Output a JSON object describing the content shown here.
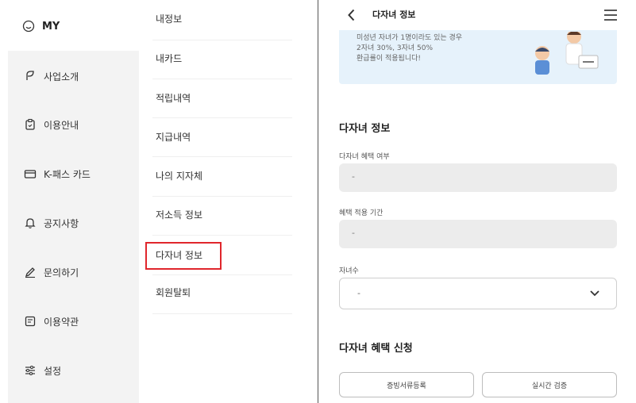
{
  "left": {
    "my_label": "MY",
    "sidebar_items": [
      {
        "label": "사업소개",
        "icon": "leaf-icon"
      },
      {
        "label": "이용안내",
        "icon": "clipboard-icon"
      },
      {
        "label": "K-패스 카드",
        "icon": "card-icon"
      },
      {
        "label": "공지사항",
        "icon": "bell-icon"
      },
      {
        "label": "문의하기",
        "icon": "pencil-icon"
      },
      {
        "label": "이용약관",
        "icon": "document-icon"
      },
      {
        "label": "설정",
        "icon": "settings-icon"
      }
    ],
    "submenu_items": [
      "내정보",
      "내카드",
      "적립내역",
      "지급내역",
      "나의 지자체",
      "저소득 정보",
      "다자녀 정보",
      "회원탈퇴"
    ],
    "highlight_color": "#e0262c"
  },
  "right": {
    "title": "다자녀 정보",
    "banner_lines": [
      "미성년 자녀가 1명이라도 있는 경우",
      "2자녀 30%, 3자녀 50%",
      "환급률이 적용됩니다!"
    ],
    "section_info_title": "다자녀 정보",
    "field1_label": "다자녀 혜택 여부",
    "field1_value": "-",
    "field2_label": "혜택 적용 기간",
    "field2_value": "-",
    "field3_label": "자녀수",
    "field3_value": "-",
    "section_apply_title": "다자녀 혜택 신청",
    "btn_docs": "증빙서류등록",
    "btn_verify": "실시간 검증",
    "banner_color": "#e6f2fb"
  }
}
